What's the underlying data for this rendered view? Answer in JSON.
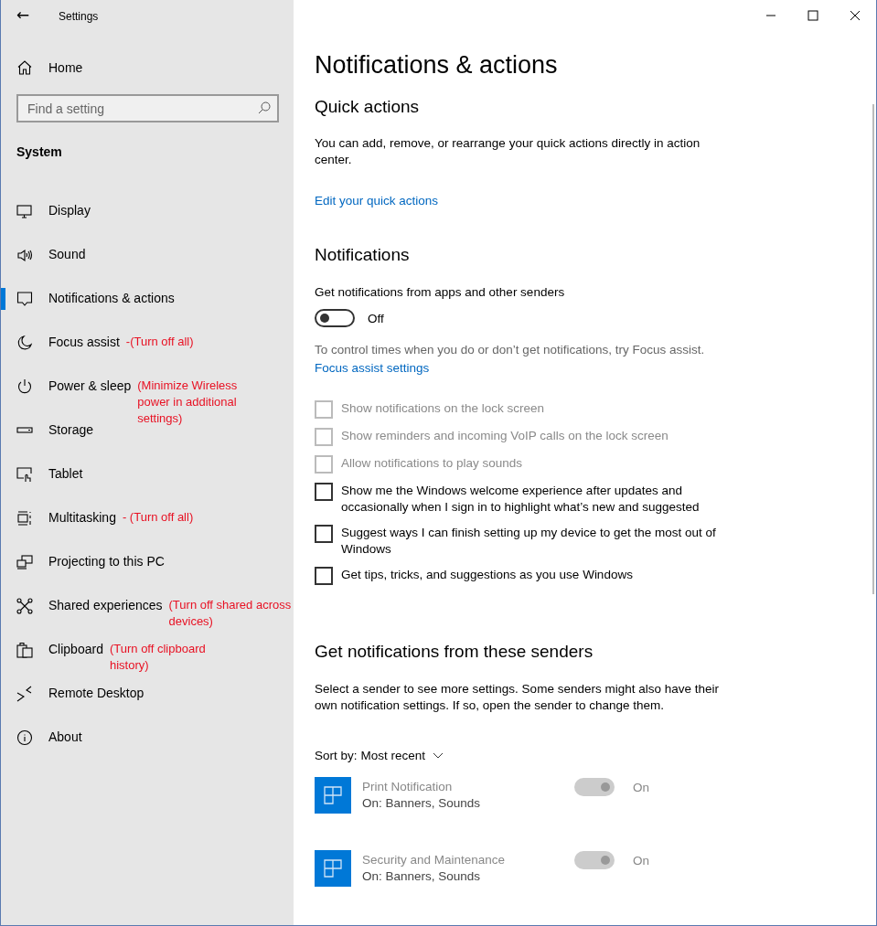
{
  "window": {
    "title": "Settings",
    "back": "←"
  },
  "sidebar": {
    "home": "Home",
    "search": {
      "placeholder": "Find a setting"
    },
    "section": "System",
    "items": [
      {
        "kind": "display",
        "label": "Display",
        "selected": false
      },
      {
        "kind": "sound",
        "label": "Sound",
        "selected": false
      },
      {
        "kind": "notifications",
        "label": "Notifications & actions",
        "selected": true
      },
      {
        "kind": "focus",
        "label": "Focus assist",
        "selected": false,
        "note": "-(Turn off all)"
      },
      {
        "kind": "power",
        "label": "Power & sleep",
        "selected": false,
        "note": "(Minimize Wireless power in additional settings)"
      },
      {
        "kind": "storage",
        "label": "Storage",
        "selected": false
      },
      {
        "kind": "tablet",
        "label": "Tablet",
        "selected": false
      },
      {
        "kind": "multitasking",
        "label": "Multitasking",
        "selected": false,
        "note": "- (Turn off all)"
      },
      {
        "kind": "projecting",
        "label": "Projecting to this PC",
        "selected": false
      },
      {
        "kind": "shared",
        "label": "Shared experiences",
        "selected": false,
        "note": "(Turn off shared across devices)"
      },
      {
        "kind": "clipboard",
        "label": "Clipboard",
        "selected": false,
        "note": "(Turn off clipboard history)"
      },
      {
        "kind": "remote",
        "label": "Remote Desktop",
        "selected": false
      },
      {
        "kind": "about",
        "label": "About",
        "selected": false
      }
    ]
  },
  "page": {
    "title": "Notifications & actions",
    "quick_actions": {
      "heading": "Quick actions",
      "text": "You can add, remove, or rearrange your quick actions directly in action center.",
      "link": "Edit your quick actions"
    },
    "notifications": {
      "heading": "Notifications",
      "toggle_label": "Get notifications from apps and other senders",
      "toggle": {
        "on": false,
        "state": "Off"
      },
      "hint": "To control times when you do or don’t get notifications, try Focus assist.",
      "link": "Focus assist settings",
      "checkboxes": [
        {
          "label": "Show notifications on the lock screen",
          "checked": false,
          "disabled": true
        },
        {
          "label": "Show reminders and incoming VoIP calls on the lock screen",
          "checked": false,
          "disabled": true
        },
        {
          "label": "Allow notifications to play sounds",
          "checked": false,
          "disabled": true
        },
        {
          "label": "Show me the Windows welcome experience after updates and occasionally when I sign in to highlight what’s new and suggested",
          "checked": false,
          "disabled": false
        },
        {
          "label": "Suggest ways I can finish setting up my device to get the most out of Windows",
          "checked": false,
          "disabled": false
        },
        {
          "label": "Get tips, tricks, and suggestions as you use Windows",
          "checked": false,
          "disabled": false
        }
      ]
    },
    "senders": {
      "heading": "Get notifications from these senders",
      "text": "Select a sender to see more settings. Some senders might also have their own notification settings. If so, open the sender to change them.",
      "sort_label": "Sort by:",
      "sort_value": "Most recent",
      "items": [
        {
          "name": "Print Notification",
          "detail": "On: Banners, Sounds",
          "on": true,
          "disabled": true,
          "state": "On"
        },
        {
          "name": "Security and Maintenance",
          "detail": "On: Banners, Sounds",
          "on": true,
          "disabled": true,
          "state": "On"
        }
      ]
    }
  }
}
